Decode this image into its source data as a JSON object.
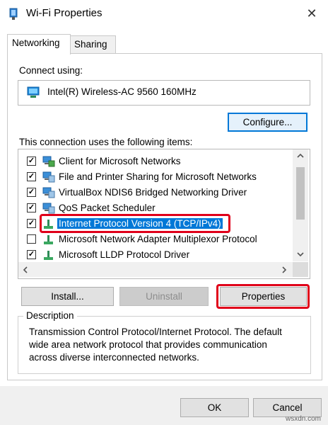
{
  "window": {
    "title": "Wi-Fi Properties",
    "close_glyph": "✕"
  },
  "tabs": [
    {
      "label": "Networking"
    },
    {
      "label": "Sharing"
    }
  ],
  "connect_using": {
    "label": "Connect using:",
    "adapter": "Intel(R) Wireless-AC 9560 160MHz",
    "configure_label": "Configure..."
  },
  "items_label": "This connection uses the following items:",
  "items": [
    {
      "label": "Client for Microsoft Networks",
      "checked": true,
      "icon": "network-client-icon"
    },
    {
      "label": "File and Printer Sharing for Microsoft Networks",
      "checked": true,
      "icon": "network-service-icon"
    },
    {
      "label": "VirtualBox NDIS6 Bridged Networking Driver",
      "checked": true,
      "icon": "network-service-icon"
    },
    {
      "label": "QoS Packet Scheduler",
      "checked": true,
      "icon": "network-service-icon"
    },
    {
      "label": "Internet Protocol Version 4 (TCP/IPv4)",
      "checked": true,
      "icon": "protocol-icon",
      "selected": true
    },
    {
      "label": "Microsoft Network Adapter Multiplexor Protocol",
      "checked": false,
      "icon": "protocol-icon"
    },
    {
      "label": "Microsoft LLDP Protocol Driver",
      "checked": true,
      "icon": "protocol-icon"
    }
  ],
  "buttons": {
    "install": "Install...",
    "uninstall": "Uninstall",
    "properties": "Properties",
    "ok": "OK",
    "cancel": "Cancel"
  },
  "description": {
    "title": "Description",
    "line1": "Transmission Control Protocol/Internet Protocol. The default",
    "line2": "wide area network protocol that provides communication",
    "line3": "across diverse interconnected networks."
  },
  "check_glyph": "✓",
  "colors": {
    "selection": "#0078d7",
    "highlight_box": "#e0001a",
    "focus_border": "#0078d7"
  },
  "watermark": "wsxdn.com"
}
